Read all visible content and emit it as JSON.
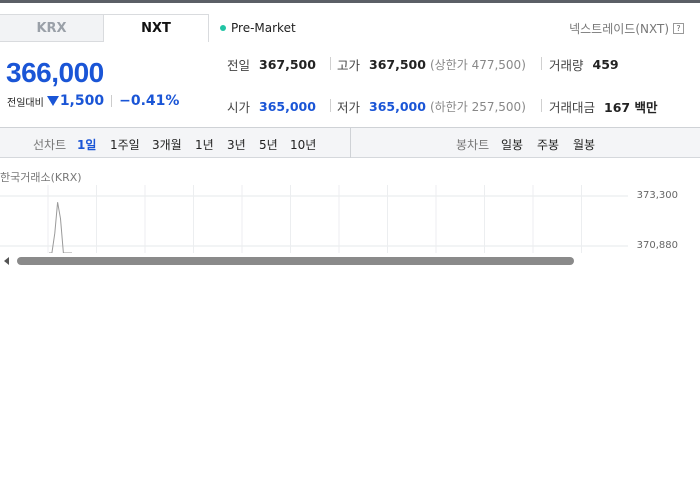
{
  "tabs": [
    {
      "label": "KRX",
      "active": false
    },
    {
      "label": "NXT",
      "active": true
    }
  ],
  "session": {
    "label": "Pre-Market",
    "dot_color": "#21c4a4"
  },
  "nxt_link": {
    "label": "넥스트레이드(NXT)",
    "help_icon": "?"
  },
  "price": {
    "current": "366,000",
    "change_label": "전일대비",
    "direction": "down",
    "change_amount": "1,500",
    "change_percent": "−0.41%"
  },
  "stats": {
    "prev_close": {
      "label": "전일",
      "value": "367,500"
    },
    "high": {
      "label": "고가",
      "value": "367,500",
      "limit": "(상한가 477,500)"
    },
    "volume": {
      "label": "거래량",
      "value": "459"
    },
    "open": {
      "label": "시가",
      "value": "365,000"
    },
    "low": {
      "label": "저가",
      "value": "365,000",
      "limit": "(하한가 257,500)"
    },
    "amount": {
      "label": "거래대금",
      "value": "167 백만"
    }
  },
  "toolbar": {
    "line_chart_label": "선차트",
    "line_periods": [
      {
        "label": "1일",
        "active": true
      },
      {
        "label": "1주일",
        "active": false
      },
      {
        "label": "3개월",
        "active": false
      },
      {
        "label": "1년",
        "active": false
      },
      {
        "label": "3년",
        "active": false
      },
      {
        "label": "5년",
        "active": false
      },
      {
        "label": "10년",
        "active": false
      }
    ],
    "candle_chart_label": "봉차트",
    "candle_periods": [
      {
        "label": "일봉"
      },
      {
        "label": "주봉"
      },
      {
        "label": "월봉"
      }
    ]
  },
  "chart": {
    "market_label": "한국거래소(KRX)",
    "y_ticks": [
      "373,300",
      "370,880"
    ]
  },
  "chart_data": {
    "type": "line",
    "title": "",
    "y_ticks": [
      373300,
      370880
    ],
    "series": [
      {
        "values": [
          368500,
          368800,
          371500,
          373000,
          372200,
          370500,
          369800,
          370200,
          369600
        ]
      }
    ]
  },
  "colors": {
    "accent_blue": "#1a55d6",
    "premarket_dot": "#21c4a4"
  }
}
